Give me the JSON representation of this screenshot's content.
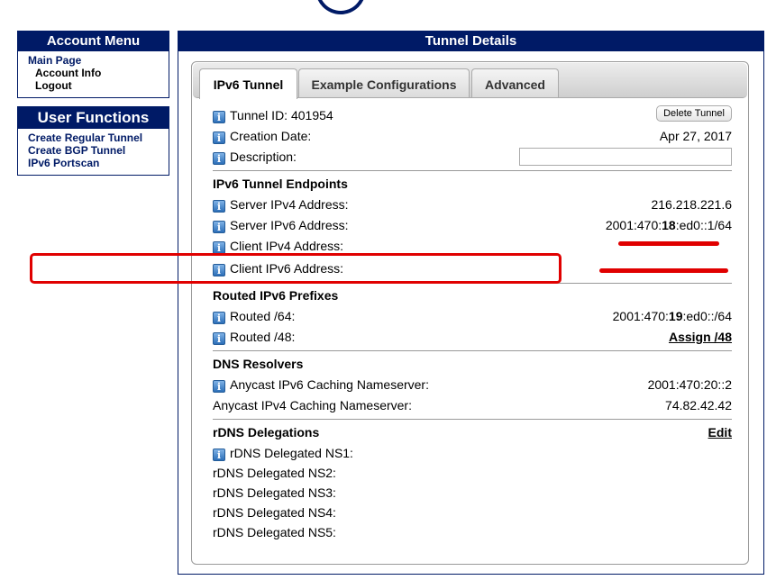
{
  "sidebar": {
    "account_menu": {
      "title": "Account Menu",
      "items": [
        "Main Page",
        "Account Info",
        "Logout"
      ]
    },
    "user_functions": {
      "title": "User Functions",
      "items": [
        "Create Regular Tunnel",
        "Create BGP Tunnel",
        "IPv6 Portscan"
      ]
    }
  },
  "main": {
    "title": "Tunnel Details",
    "tabs": [
      "IPv6 Tunnel",
      "Example Configurations",
      "Advanced"
    ],
    "active_tab": "IPv6 Tunnel",
    "tunnel_id": "Tunnel ID: 401954",
    "delete_button": "Delete Tunnel",
    "creation_date_label": "Creation Date:",
    "creation_date": "Apr 27, 2017",
    "description_label": "Description:",
    "description_value": "",
    "endpoints": {
      "title": "IPv6 Tunnel Endpoints",
      "server_ipv4_label": "Server IPv4 Address:",
      "server_ipv4": "216.218.221.6",
      "server_ipv6_label": "Server IPv6 Address:",
      "server_ipv6_prefix": "2001:470:",
      "server_ipv6_bold": "18",
      "server_ipv6_suffix": ":ed0::1/64",
      "client_ipv4_label": "Client IPv4 Address:",
      "client_ipv4": "",
      "client_ipv6_label": "Client IPv6 Address:",
      "client_ipv6": ""
    },
    "routed": {
      "title": "Routed IPv6 Prefixes",
      "r64_label": "Routed /64:",
      "r64_prefix": "2001:470:",
      "r64_bold": "19",
      "r64_suffix": ":ed0::/64",
      "r48_label": "Routed /48:",
      "r48_link": "Assign /48"
    },
    "dns": {
      "title": "DNS Resolvers",
      "ipv6_label": "Anycast IPv6 Caching Nameserver:",
      "ipv6_value": "2001:470:20::2",
      "ipv4_label": "Anycast IPv4 Caching Nameserver:",
      "ipv4_value": "74.82.42.42"
    },
    "rdns": {
      "title": "rDNS Delegations",
      "edit_link": "Edit",
      "ns": [
        "rDNS Delegated NS1:",
        "rDNS Delegated NS2:",
        "rDNS Delegated NS3:",
        "rDNS Delegated NS4:",
        "rDNS Delegated NS5:"
      ]
    }
  },
  "colors": {
    "header_navy": "#001a66",
    "highlight_red": "#e00000",
    "info_icon_blue": "#2c6fb8"
  }
}
